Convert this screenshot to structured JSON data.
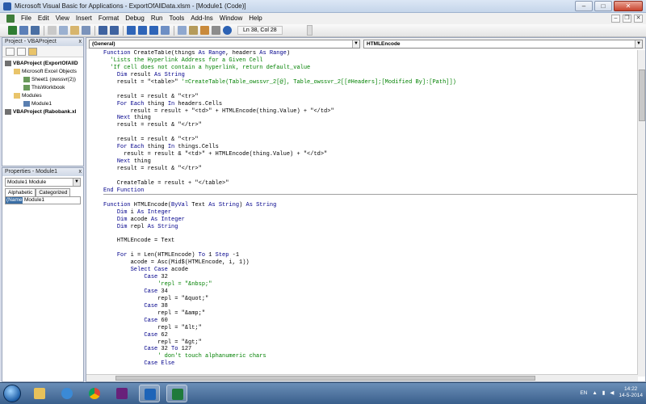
{
  "window": {
    "title": "Microsoft Visual Basic for Applications - ExportOfAllData.xlsm - [Module1 (Code)]",
    "min": "–",
    "max": "□",
    "close": "✕"
  },
  "menu": [
    "File",
    "Edit",
    "View",
    "Insert",
    "Format",
    "Debug",
    "Run",
    "Tools",
    "Add-Ins",
    "Window",
    "Help"
  ],
  "toolbar": {
    "position": "Ln 38, Col 28"
  },
  "project": {
    "title": "Project - VBAProject",
    "close": "x",
    "items": [
      "VBAProject (ExportOfAllD",
      "Microsoft Excel Objects",
      "Sheet1 (owssvr(2))",
      "ThisWorkbook",
      "Modules",
      "Module1",
      "VBAProject (Rabobank.xl"
    ]
  },
  "properties": {
    "title": "Properties - Module1",
    "close": "x",
    "object": "Module1  Module",
    "tabs": [
      "Alphabetic",
      "Categorized"
    ],
    "name_key": "(Name)",
    "name_value": "Module1"
  },
  "editor": {
    "object_combo": "(General)",
    "proc_combo": "HTMLEncode"
  },
  "code_lines": [
    {
      "t": "Function CreateTable(things As Range, headers As Range)",
      "c": "kw"
    },
    {
      "t": "  'Lists the Hyperlink Address for a Given Cell",
      "c": "cm"
    },
    {
      "t": "  'If cell does not contain a hyperlink, return default_value",
      "c": "cm"
    },
    {
      "t": "    Dim result As String",
      "c": ""
    },
    {
      "t": "    result = \"<table>\" '=CreateTable(Table_owssvr_2[@], Table_owssvr_2[[#Headers];[Modified By]:[Path]])",
      "c": ""
    },
    {
      "t": "",
      "c": ""
    },
    {
      "t": "    result = result & \"<tr>\"",
      "c": ""
    },
    {
      "t": "    For Each thing In headers.Cells",
      "c": ""
    },
    {
      "t": "        result = result + \"<td>\" + HTMLEncode(thing.Value) + \"</td>\"",
      "c": ""
    },
    {
      "t": "    Next thing",
      "c": ""
    },
    {
      "t": "    result = result & \"</tr>\"",
      "c": ""
    },
    {
      "t": "",
      "c": ""
    },
    {
      "t": "    result = result & \"<tr>\"",
      "c": ""
    },
    {
      "t": "    For Each thing In things.Cells",
      "c": ""
    },
    {
      "t": "      result = result & \"<td>\" + HTMLEncode(thing.Value) + \"</td>\"",
      "c": ""
    },
    {
      "t": "    Next thing",
      "c": ""
    },
    {
      "t": "    result = result & \"</tr>\"",
      "c": ""
    },
    {
      "t": "",
      "c": ""
    },
    {
      "t": "    CreateTable = result + \"</table>\"",
      "c": ""
    },
    {
      "t": "End Function",
      "c": "div"
    },
    {
      "t": "",
      "c": ""
    },
    {
      "t": "Function HTMLEncode(ByVal Text As String) As String",
      "c": ""
    },
    {
      "t": "    Dim i As Integer",
      "c": ""
    },
    {
      "t": "    Dim acode As Integer",
      "c": ""
    },
    {
      "t": "    Dim repl As String",
      "c": ""
    },
    {
      "t": "",
      "c": ""
    },
    {
      "t": "    HTMLEncode = Text",
      "c": ""
    },
    {
      "t": "",
      "c": ""
    },
    {
      "t": "    For i = Len(HTMLEncode) To 1 Step -1",
      "c": ""
    },
    {
      "t": "        acode = Asc(Mid$(HTMLEncode, i, 1))",
      "c": ""
    },
    {
      "t": "        Select Case acode",
      "c": ""
    },
    {
      "t": "            Case 32",
      "c": ""
    },
    {
      "t": "                'repl = \"&nbsp;\"",
      "c": "cm"
    },
    {
      "t": "            Case 34",
      "c": ""
    },
    {
      "t": "                repl = \"&quot;\"",
      "c": ""
    },
    {
      "t": "            Case 38",
      "c": ""
    },
    {
      "t": "                repl = \"&amp;\"",
      "c": ""
    },
    {
      "t": "            Case 60",
      "c": ""
    },
    {
      "t": "                repl = \"&lt;\"",
      "c": ""
    },
    {
      "t": "            Case 62",
      "c": ""
    },
    {
      "t": "                repl = \"&gt;\"",
      "c": ""
    },
    {
      "t": "            Case 32 To 127",
      "c": ""
    },
    {
      "t": "                ' don't touch alphanumeric chars",
      "c": "cm"
    },
    {
      "t": "            Case Else",
      "c": ""
    }
  ],
  "taskbar": {
    "apps": [
      "explorer",
      "ie",
      "chrome",
      "visual-studio",
      "outlook",
      "excel"
    ],
    "lang": "EN",
    "time": "14:22",
    "date": "14-5-2014"
  },
  "colors": {
    "keyword": "#00008b",
    "comment": "#008000",
    "selection": "#3a6ea5"
  }
}
